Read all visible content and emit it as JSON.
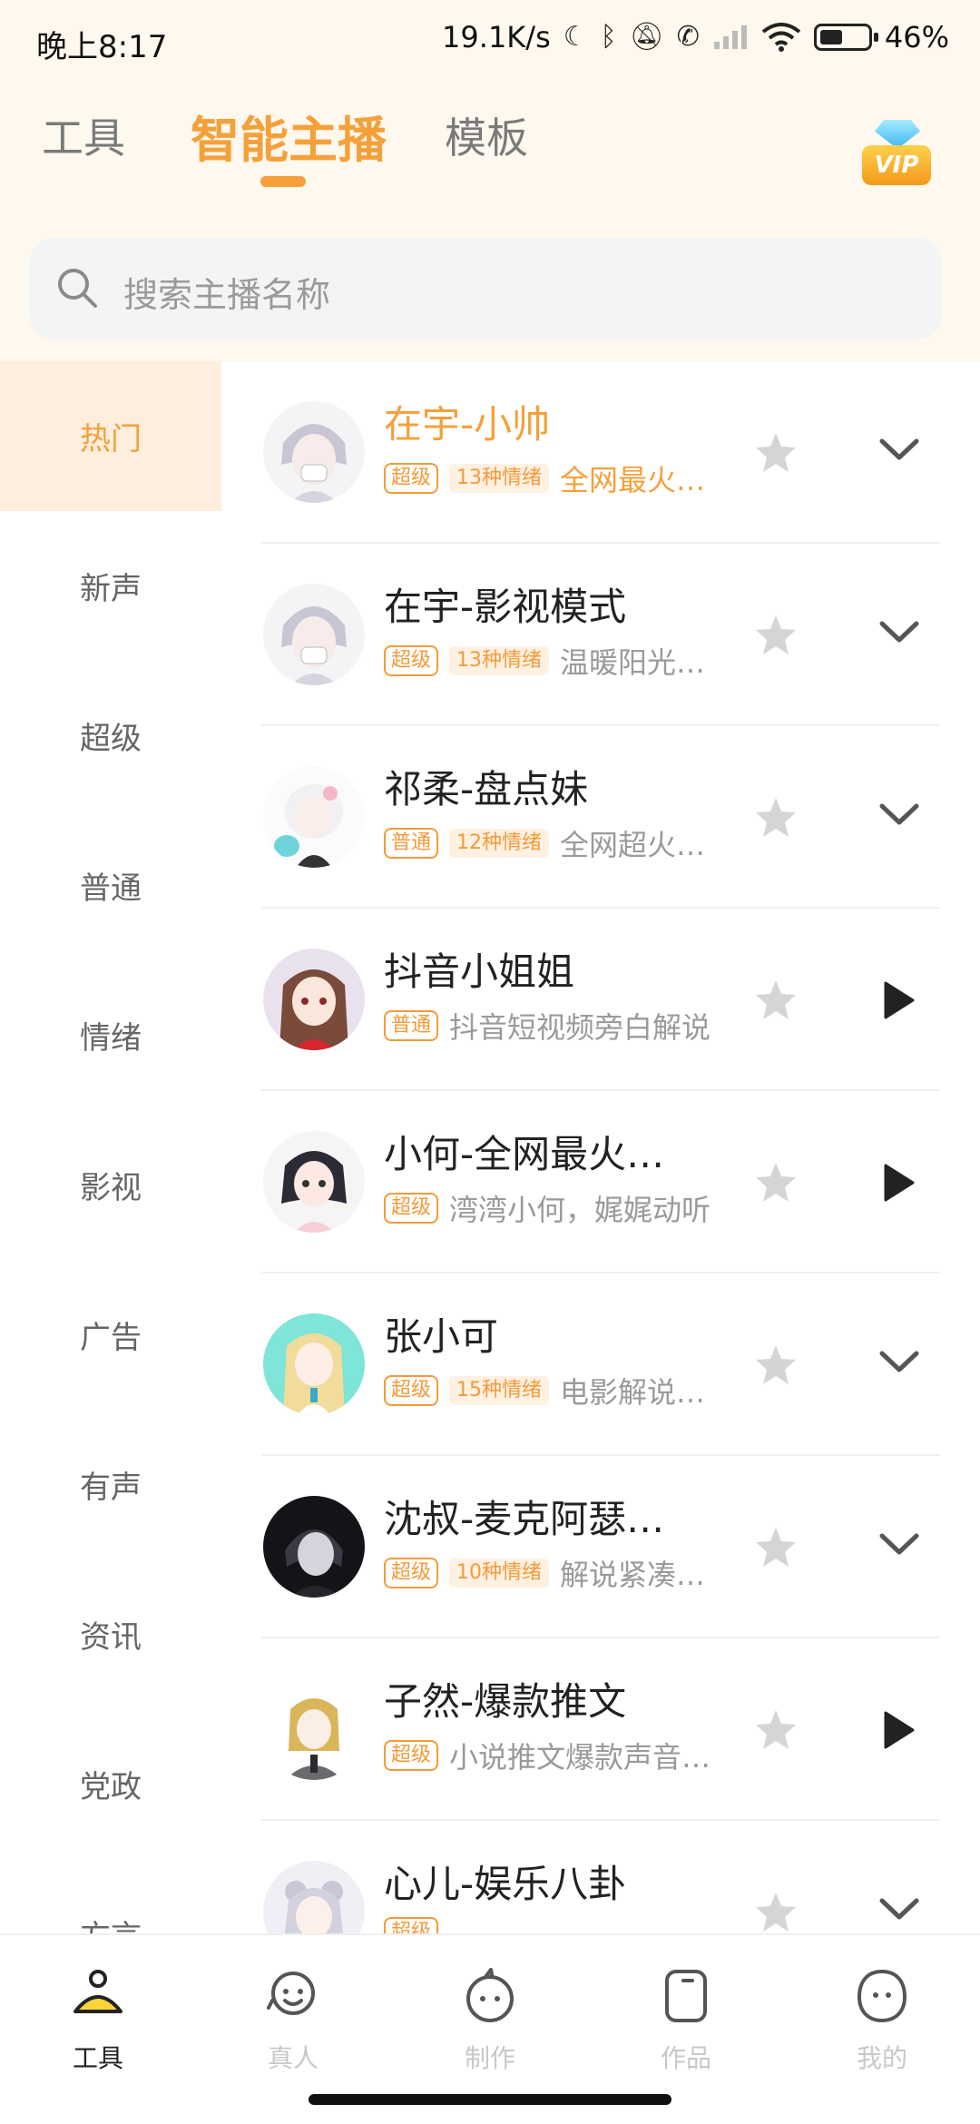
{
  "status_bar": {
    "time": "晚上8:17",
    "net_speed": "19.1K/s",
    "battery": "46%",
    "icons": [
      "moon-icon",
      "bluetooth-icon",
      "mute-icon",
      "call-icon",
      "signal-icon",
      "wifi-icon",
      "battery-icon"
    ]
  },
  "top_tabs": {
    "items": [
      {
        "label": "工具",
        "active": false
      },
      {
        "label": "智能主播",
        "active": true
      },
      {
        "label": "模板",
        "active": false
      }
    ]
  },
  "vip_badge": {
    "label": "VIP"
  },
  "search": {
    "placeholder": "搜索主播名称"
  },
  "categories": {
    "items": [
      {
        "label": "热门",
        "active": true
      },
      {
        "label": "新声"
      },
      {
        "label": "超级"
      },
      {
        "label": "普通"
      },
      {
        "label": "情绪"
      },
      {
        "label": "影视"
      },
      {
        "label": "广告"
      },
      {
        "label": "有声"
      },
      {
        "label": "资讯"
      },
      {
        "label": "党政"
      },
      {
        "label": "方言"
      }
    ]
  },
  "anchors": [
    {
      "name": "在宇-小帅",
      "highlight": true,
      "level": "超级",
      "emotion": "13种情绪",
      "desc": "全网最火…",
      "action": "chevron-down-icon"
    },
    {
      "name": "在宇-影视模式",
      "highlight": false,
      "level": "超级",
      "emotion": "13种情绪",
      "desc": "温暖阳光…",
      "action": "chevron-down-icon"
    },
    {
      "name": "祁柔-盘点妹",
      "highlight": false,
      "level": "普通",
      "emotion": "12种情绪",
      "desc": "全网超火…",
      "action": "chevron-down-icon"
    },
    {
      "name": "抖音小姐姐",
      "highlight": false,
      "level": "普通",
      "emotion": "",
      "desc": "抖音短视频旁白解说",
      "action": "play-icon"
    },
    {
      "name": "小何-全网最火…",
      "highlight": false,
      "level": "超级",
      "emotion": "",
      "desc": "湾湾小何，娓娓动听",
      "action": "play-icon"
    },
    {
      "name": "张小可",
      "highlight": false,
      "level": "超级",
      "emotion": "15种情绪",
      "desc": "电影解说…",
      "action": "chevron-down-icon"
    },
    {
      "name": "沈叔-麦克阿瑟…",
      "highlight": false,
      "level": "超级",
      "emotion": "10种情绪",
      "desc": "解说紧凑…",
      "action": "chevron-down-icon"
    },
    {
      "name": "子然-爆款推文",
      "highlight": false,
      "level": "超级",
      "emotion": "",
      "desc": "小说推文爆款声音…",
      "action": "play-icon"
    },
    {
      "name": "心儿-娱乐八卦",
      "highlight": false,
      "level": "超级",
      "emotion": "",
      "desc": "",
      "action": "chevron-down-icon"
    }
  ],
  "bottom_nav": {
    "items": [
      {
        "label": "工具",
        "icon": "tools-icon",
        "active": true
      },
      {
        "label": "真人",
        "icon": "person-icon",
        "active": false
      },
      {
        "label": "制作",
        "icon": "create-icon",
        "active": false
      },
      {
        "label": "作品",
        "icon": "works-icon",
        "active": false
      },
      {
        "label": "我的",
        "icon": "profile-icon",
        "active": false
      }
    ]
  },
  "colors": {
    "accent": "#f5a03a",
    "header_bg": "#fff8ee",
    "active_cat_bg": "#fdeede"
  }
}
